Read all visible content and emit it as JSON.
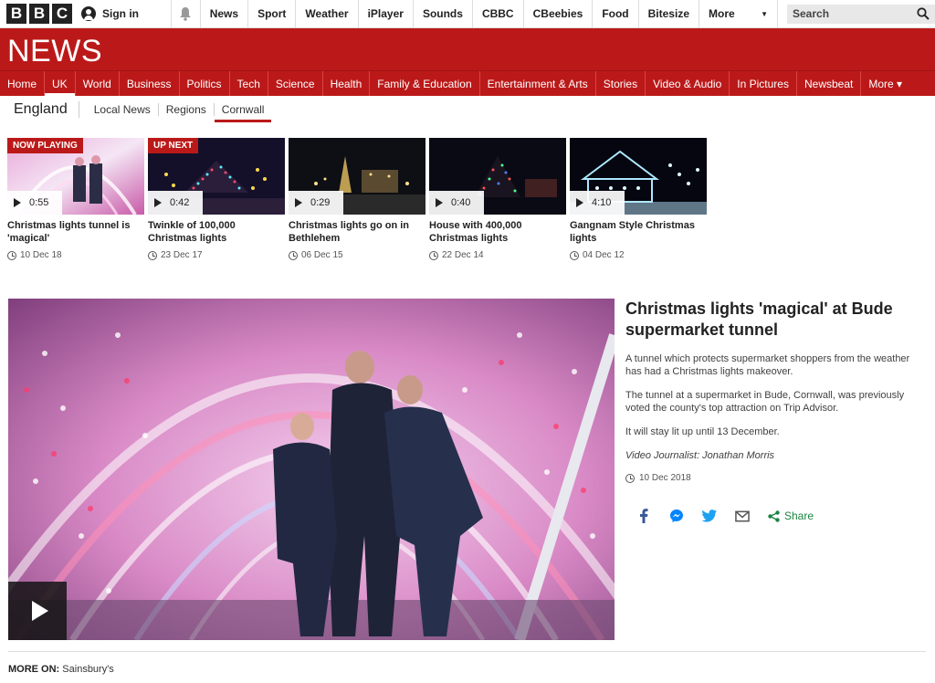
{
  "masthead": {
    "logo_letters": [
      "B",
      "B",
      "C"
    ],
    "signin_label": "Sign in",
    "nav": [
      "News",
      "Sport",
      "Weather",
      "iPlayer",
      "Sounds",
      "CBBC",
      "CBeebies",
      "Food",
      "Bitesize"
    ],
    "more_label": "More",
    "search_placeholder": "Search"
  },
  "brand": {
    "title": "NEWS",
    "color": "#bb1919"
  },
  "section_nav": [
    {
      "label": "Home"
    },
    {
      "label": "UK",
      "active": true
    },
    {
      "label": "World"
    },
    {
      "label": "Business"
    },
    {
      "label": "Politics"
    },
    {
      "label": "Tech"
    },
    {
      "label": "Science"
    },
    {
      "label": "Health"
    },
    {
      "label": "Family & Education"
    },
    {
      "label": "Entertainment & Arts"
    },
    {
      "label": "Stories"
    },
    {
      "label": "Video & Audio"
    },
    {
      "label": "In Pictures"
    },
    {
      "label": "Newsbeat"
    },
    {
      "label": "More ▾"
    }
  ],
  "sub_nav": {
    "region": "England",
    "items": [
      {
        "label": "Local News"
      },
      {
        "label": "Regions"
      },
      {
        "label": "Cornwall",
        "active": true
      }
    ]
  },
  "playlist": [
    {
      "badge": "NOW PLAYING",
      "duration": "0:55",
      "title": "Christmas lights tunnel is 'magical'",
      "date": "10 Dec 18"
    },
    {
      "badge": "UP NEXT",
      "duration": "0:42",
      "title": "Twinkle of 100,000 Christmas lights",
      "date": "23 Dec 17"
    },
    {
      "badge": "",
      "duration": "0:29",
      "title": "Christmas lights go on in Bethlehem",
      "date": "06 Dec 15"
    },
    {
      "badge": "",
      "duration": "0:40",
      "title": "House with 400,000 Christmas lights",
      "date": "22 Dec 14"
    },
    {
      "badge": "",
      "duration": "4:10",
      "title": "Gangnam Style Christmas lights",
      "date": "04 Dec 12"
    }
  ],
  "article": {
    "headline": "Christmas lights 'magical' at Bude supermarket tunnel",
    "paragraphs": [
      "A tunnel which protects supermarket shoppers from the weather has had a Christmas lights makeover.",
      "The tunnel at a supermarket in Bude, Cornwall, was previously voted the county's top attraction on Trip Advisor.",
      "It will stay lit up until 13 December."
    ],
    "byline": "Video Journalist: Jonathan Morris",
    "date": "10 Dec 2018",
    "share_label": "Share"
  },
  "more_on": {
    "label": "MORE ON:",
    "topic": "Sainsbury's"
  }
}
